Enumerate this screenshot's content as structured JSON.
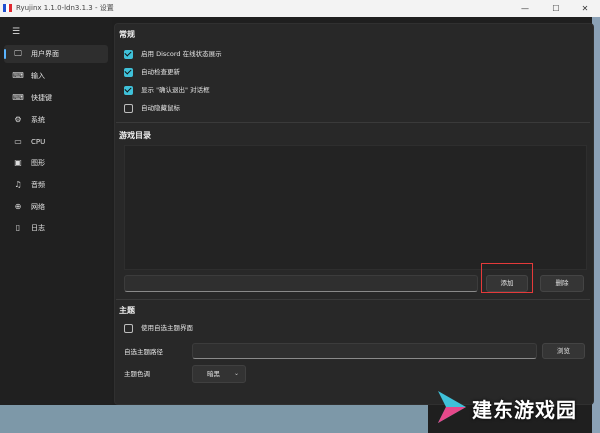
{
  "window": {
    "title": "Ryujinx 1.1.0-ldn3.1.3 - 设置",
    "controls": {
      "minimize": "—",
      "maximize": "☐",
      "close": "✕"
    }
  },
  "sidebar": {
    "items": [
      {
        "label": "用户界面",
        "icon": "monitor-icon",
        "glyph": "🖵",
        "active": true
      },
      {
        "label": "输入",
        "icon": "gamepad-icon",
        "glyph": "⌨"
      },
      {
        "label": "快捷键",
        "icon": "keyboard-icon",
        "glyph": "⌨"
      },
      {
        "label": "系统",
        "icon": "gear-icon",
        "glyph": "⚙"
      },
      {
        "label": "CPU",
        "icon": "cpu-icon",
        "glyph": "▭"
      },
      {
        "label": "图形",
        "icon": "image-icon",
        "glyph": "▣"
      },
      {
        "label": "音频",
        "icon": "music-icon",
        "glyph": "♫"
      },
      {
        "label": "网络",
        "icon": "globe-icon",
        "glyph": "⊕"
      },
      {
        "label": "日志",
        "icon": "document-icon",
        "glyph": "▯"
      }
    ]
  },
  "general": {
    "title": "常规",
    "options": [
      {
        "label": "启用 Discord 在线状态展示",
        "checked": true
      },
      {
        "label": "自动检查更新",
        "checked": true
      },
      {
        "label": "显示 \"确认退出\" 对话框",
        "checked": true
      },
      {
        "label": "自动隐藏鼠标",
        "checked": false
      }
    ]
  },
  "game_dirs": {
    "title": "游戏目录",
    "path_value": "",
    "add_label": "添加",
    "remove_label": "删除"
  },
  "theme": {
    "title": "主题",
    "custom_theme_label": "使用自选主题界面",
    "custom_theme_checked": false,
    "path_label": "自选主题路径",
    "path_value": "",
    "browse_label": "浏览",
    "color_label": "主题色调",
    "color_value": "暗黑"
  },
  "watermark": {
    "text": "建东游戏园"
  },
  "colors": {
    "accent": "#3fc1d9",
    "highlight": "#e53a3a",
    "background": "#1f1f1f",
    "panel": "#282828"
  }
}
